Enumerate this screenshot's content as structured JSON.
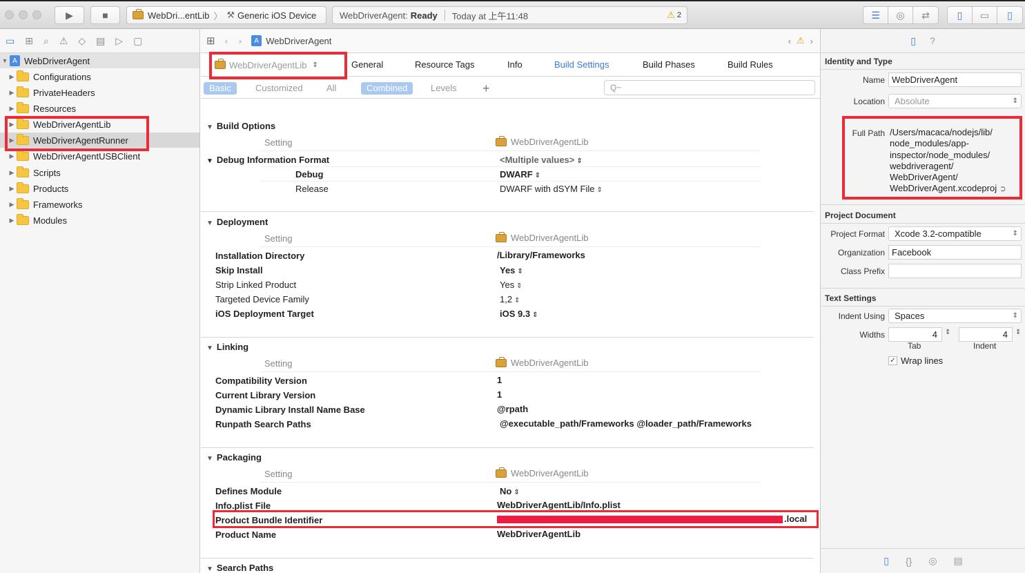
{
  "toolbar": {
    "scheme_name": "WebDri...entLib",
    "device": "Generic iOS Device",
    "activity_app": "WebDriverAgent:",
    "activity_status": "Ready",
    "activity_time": "Today at 上午11:48",
    "warning_count": "2",
    "warning_icon": "⚠"
  },
  "navigator": {
    "items": [
      {
        "label": "WebDriverAgent"
      },
      {
        "label": "Configurations"
      },
      {
        "label": "PrivateHeaders"
      },
      {
        "label": "Resources"
      },
      {
        "label": "WebDriverAgentLib"
      },
      {
        "label": "WebDriverAgentRunner"
      },
      {
        "label": "WebDriverAgentUSBClient"
      },
      {
        "label": "Scripts"
      },
      {
        "label": "Products"
      },
      {
        "label": "Frameworks"
      },
      {
        "label": "Modules"
      }
    ]
  },
  "jumpbar": {
    "path": "WebDriverAgent"
  },
  "editor": {
    "target": "WebDriverAgentLib",
    "tabs": [
      "General",
      "Resource Tags",
      "Info",
      "Build Settings",
      "Build Phases",
      "Build Rules"
    ],
    "filters": [
      "Basic",
      "Customized",
      "All",
      "Combined",
      "Levels"
    ],
    "add": "+",
    "search_placeholder": "Q~"
  },
  "settings": {
    "header_setting": "Setting",
    "header_target": "WebDriverAgentLib",
    "build_options": {
      "title": "Build Options",
      "debug_info": {
        "label": "Debug Information Format",
        "value": "<Multiple values>",
        "debug_label": "Debug",
        "debug_value": "DWARF",
        "release_label": "Release",
        "release_value": "DWARF with dSYM File"
      }
    },
    "deployment": {
      "title": "Deployment",
      "rows": [
        {
          "label": "Installation Directory",
          "value": "/Library/Frameworks"
        },
        {
          "label": "Skip Install",
          "value": "Yes"
        },
        {
          "label": "Strip Linked Product",
          "value": "Yes"
        },
        {
          "label": "Targeted Device Family",
          "value": "1,2"
        },
        {
          "label": "iOS Deployment Target",
          "value": "iOS 9.3"
        }
      ]
    },
    "linking": {
      "title": "Linking",
      "rows": [
        {
          "label": "Compatibility Version",
          "value": "1"
        },
        {
          "label": "Current Library Version",
          "value": "1"
        },
        {
          "label": "Dynamic Library Install Name Base",
          "value": "@rpath"
        },
        {
          "label": "Runpath Search Paths",
          "value": "@executable_path/Frameworks @loader_path/Frameworks"
        }
      ]
    },
    "packaging": {
      "title": "Packaging",
      "rows": [
        {
          "label": "Defines Module",
          "value": "No"
        },
        {
          "label": "Info.plist File",
          "value": "WebDriverAgentLib/Info.plist"
        },
        {
          "label": "Product Bundle Identifier",
          "value": ".local"
        },
        {
          "label": "Product Name",
          "value": "WebDriverAgentLib"
        }
      ]
    },
    "search_paths": {
      "title": "Search Paths"
    }
  },
  "inspector": {
    "identity": {
      "title": "Identity and Type",
      "name_label": "Name",
      "name_value": "WebDriverAgent",
      "location_label": "Location",
      "location_value": "Absolute",
      "fullpath_label": "Full Path",
      "fullpath_lines": [
        "/Users/macaca/nodejs/lib/",
        "node_modules/app-",
        "inspector/node_modules/",
        "webdriveragent/",
        "WebDriverAgent/",
        "WebDriverAgent.xcodeproj"
      ]
    },
    "project_document": {
      "title": "Project Document",
      "format_label": "Project Format",
      "format_value": "Xcode 3.2-compatible",
      "org_label": "Organization",
      "org_value": "Facebook",
      "prefix_label": "Class Prefix",
      "prefix_value": ""
    },
    "text_settings": {
      "title": "Text Settings",
      "indent_label": "Indent Using",
      "indent_value": "Spaces",
      "widths_label": "Widths",
      "tab_value": "4",
      "indent_width_value": "4",
      "tab_caption": "Tab",
      "indent_caption": "Indent",
      "wrap_label": "Wrap lines"
    }
  },
  "colors": {
    "accent": "#3a7bd5",
    "highlight": "#ee2a35",
    "folder": "#f5c642"
  }
}
